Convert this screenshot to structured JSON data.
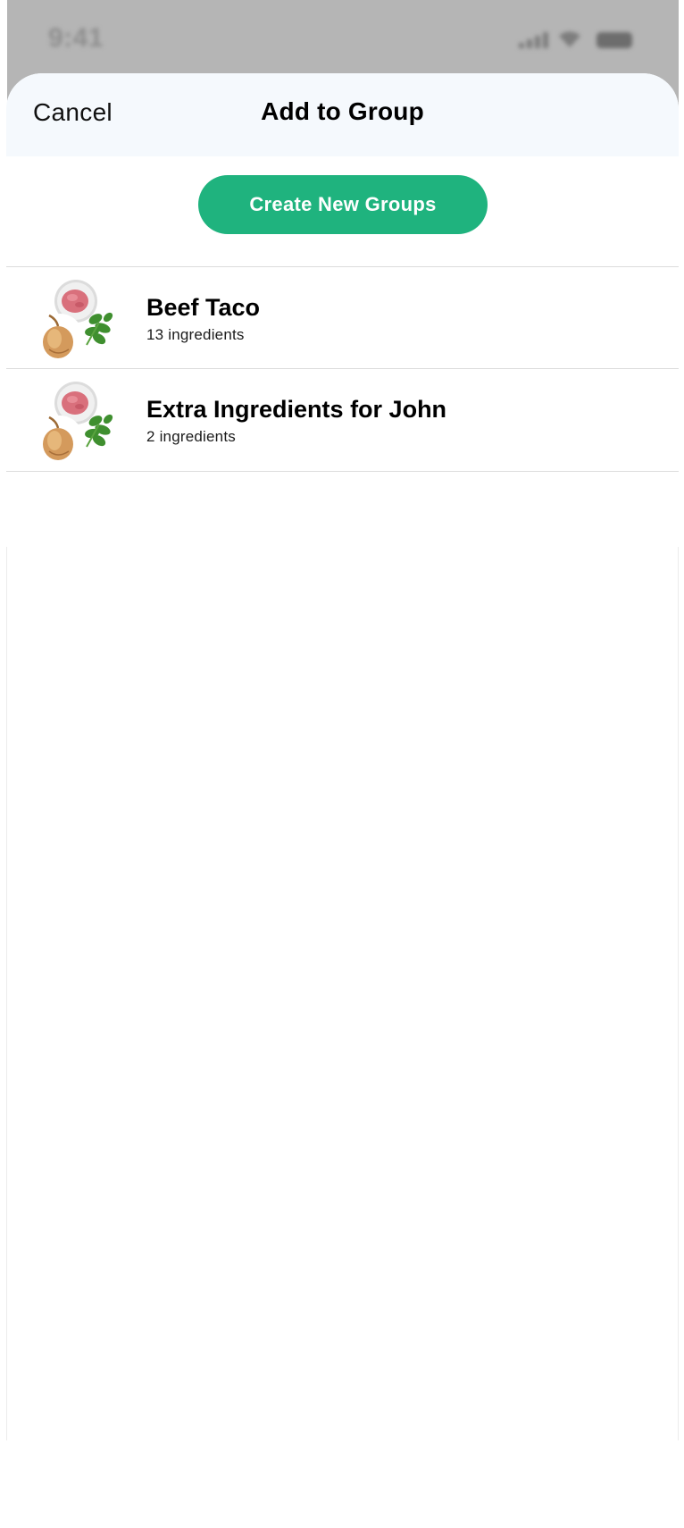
{
  "status_bar": {
    "time": "9:41",
    "icons": [
      "cellular-signal-icon",
      "wifi-icon",
      "battery-icon"
    ]
  },
  "header": {
    "cancel_label": "Cancel",
    "title": "Add to Group"
  },
  "actions": {
    "create_label": "Create New Groups"
  },
  "groups": [
    {
      "name": "Beef Taco",
      "count_label": "13 ingredients",
      "thumbnail": "ingredients-collage-icon"
    },
    {
      "name": "Extra Ingredients for John",
      "count_label": "2 ingredients",
      "thumbnail": "ingredients-collage-icon"
    }
  ],
  "colors": {
    "accent": "#1fb37e",
    "header_bg": "#f5f9fd",
    "backdrop": "#b5b5b5"
  }
}
